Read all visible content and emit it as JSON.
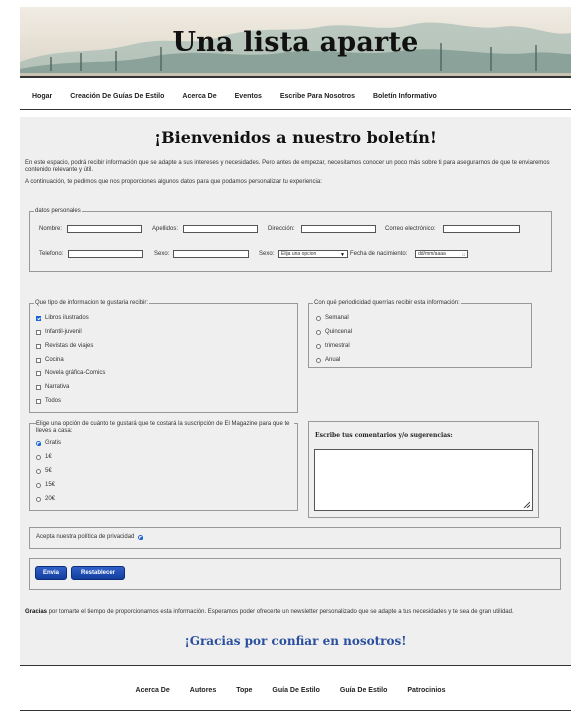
{
  "header": {
    "title": "Una lista aparte"
  },
  "nav": [
    "Hogar",
    "Creación De Guías De Estilo",
    "Acerca De",
    "Eventos",
    "Escribe Para Nosotros",
    "Boletín Informativo"
  ],
  "main": {
    "title": "¡Bienvenidos a nuestro boletín!",
    "intro1": "En este espacio, podrá recibir información que se adapte a sus intereses y necesidades. Pero antes de empezar, necesitamos conocer un poco más sobre ti para asegurarnos de que te enviaremos contenido relevante y útil.",
    "intro2": "A continuación, te pedimos que nos proporciones algunos datos para que podamos personalizar tu experiencia:"
  },
  "personal": {
    "legend": "datos personales",
    "nombre": "Nombre:",
    "apellidos": "Apellidos:",
    "direccion": "Dirección:",
    "email": "Correo electrónico:",
    "telefono": "Telefono:",
    "sexo1": "Sexo:",
    "sexo2": "Sexo:",
    "sexo_select": "Elija una opcion",
    "fecha": "Fecha de nacimiento:",
    "fecha_placeholder": "dd/mm/aaaa"
  },
  "info": {
    "legend": "Que tipo de informacion te gustaria recibir:",
    "options": [
      {
        "label": "Libros ilustrados",
        "checked": true
      },
      {
        "label": "Infantil-juvenil",
        "checked": false
      },
      {
        "label": "Revistas de viajes",
        "checked": false
      },
      {
        "label": "Cocina",
        "checked": false
      },
      {
        "label": "Novela gráfica-Comics",
        "checked": false
      },
      {
        "label": "Narrativa",
        "checked": false
      },
      {
        "label": "Todos",
        "checked": false
      }
    ]
  },
  "frequency": {
    "legend": "Con qué periodicidad querrías recibir esta información:",
    "options": [
      "Semanal",
      "Quincenal",
      "trimestral",
      "Anual"
    ]
  },
  "price": {
    "legend": "Elige una opción de cuánto te gustará que te costará la suscripción de El Magazine para que te lleves a casa:",
    "options": [
      {
        "label": "Gratis",
        "checked": true
      },
      {
        "label": "1€",
        "checked": false
      },
      {
        "label": "5€",
        "checked": false
      },
      {
        "label": "15€",
        "checked": false
      },
      {
        "label": "20€",
        "checked": false
      }
    ]
  },
  "comments": {
    "label": "Escribe tus comentarios y/o sugerencias:"
  },
  "privacy": {
    "label": "Acepta nuestra política de privacidad"
  },
  "buttons": {
    "send": "Envia",
    "reset": "Restablecer"
  },
  "thanks": {
    "bold": "Gracias",
    "text": " por tomarte el tiempo de proporcionarnos esta información. Esperamos poder ofrecerte un newsletter personalizado que se adapte a tus necesidades y te sea de gran utilidad.",
    "title": "¡Gracias por confiar en nosotros!"
  },
  "footer": [
    "Acerca De",
    "Autores",
    "Tope",
    "Guía De Estilo",
    "Guía De Estilo",
    "Patrocinios"
  ],
  "colors": {
    "accent": "#1a63d6",
    "title_blue": "#2a4f9e",
    "button": "#123f9e"
  }
}
